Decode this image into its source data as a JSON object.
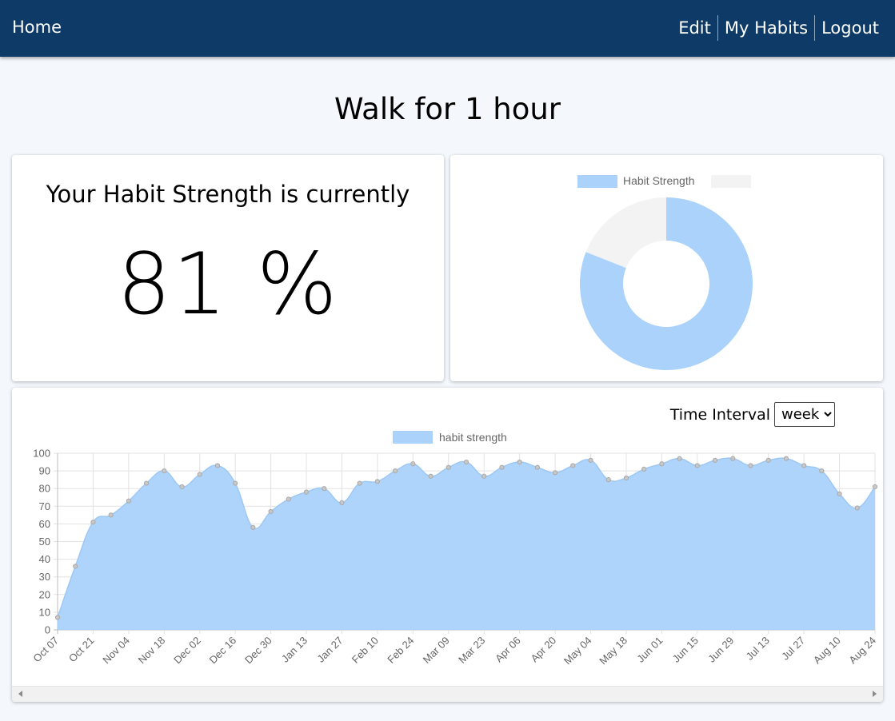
{
  "nav": {
    "home": "Home",
    "links": [
      "Edit",
      "My Habits",
      "Logout"
    ]
  },
  "page": {
    "title": "Walk for 1 hour"
  },
  "strength": {
    "caption": "Your Habit Strength is currently",
    "value_text": "81 %"
  },
  "donut": {
    "legend_label": "Habit Strength",
    "value": 81,
    "remainder": 19,
    "fill_color": "#aad2fb",
    "remainder_color": "#f3f3f3"
  },
  "interval": {
    "label": "Time Interval",
    "selected": "week"
  },
  "colors": {
    "navbar": "#0d3a66",
    "area_fill": "#aad2fb",
    "background": "#f4f8fd"
  },
  "chart_data": {
    "type": "area",
    "legend": "habit strength",
    "grid": true,
    "ylim": [
      0,
      100
    ],
    "yticks": [
      0,
      10,
      20,
      30,
      40,
      50,
      60,
      70,
      80,
      90,
      100
    ],
    "x_tick_labels": [
      "Oct 07",
      "Oct 21",
      "Nov 04",
      "Nov 18",
      "Dec 02",
      "Dec 16",
      "Dec 30",
      "Jan 13",
      "Jan 27",
      "Feb 10",
      "Feb 24",
      "Mar 09",
      "Mar 23",
      "Apr 06",
      "Apr 20",
      "May 04",
      "May 18",
      "Jun 01",
      "Jun 15",
      "Jun 29",
      "Jul 13",
      "Jul 27",
      "Aug 10",
      "Aug 24"
    ],
    "series": [
      {
        "name": "habit strength",
        "values": [
          7,
          36,
          61,
          65,
          73,
          83,
          90,
          81,
          88,
          93,
          83,
          58,
          67,
          74,
          78,
          80,
          72,
          83,
          84,
          90,
          94,
          87,
          92,
          95,
          87,
          92,
          95,
          92,
          89,
          93,
          96,
          85,
          86,
          91,
          94,
          97,
          93,
          96,
          97,
          93,
          96,
          97,
          93,
          90,
          77,
          69,
          81
        ]
      }
    ]
  }
}
